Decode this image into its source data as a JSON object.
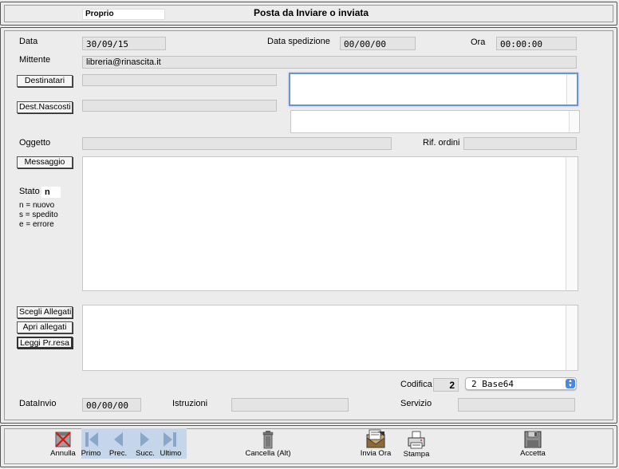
{
  "header": {
    "badge": "Proprio",
    "title": "Posta da Inviare o inviata"
  },
  "form": {
    "data_label": "Data",
    "data_value": "30/09/15",
    "data_spedizione_label": "Data spedizione",
    "data_spedizione_value": "00/00/00",
    "ora_label": "Ora",
    "ora_value": "00:00:00",
    "mittente_label": "Mittente",
    "mittente_value": "libreria@rinascita.it",
    "destinatari_button": "Destinatari",
    "dest_nascosti_button": "Dest.Nascosti",
    "oggetto_label": "Oggetto",
    "rif_ordini_label": "Rif. ordini",
    "messaggio_button": "Messaggio",
    "stato_label": "Stato",
    "stato_value": "n",
    "legend": [
      "n = nuovo",
      "s = spedito",
      "e = errore"
    ],
    "scegli_allegati_button": "Scegli Allegati",
    "apri_allegati_button": "Apri allegati",
    "leggi_prresa_button": "Leggi Pr.resa",
    "codifica_label": "Codifica",
    "codifica_number": "2",
    "codifica_select": "2 Base64",
    "data_invio_label": "DataInvio",
    "data_invio_value": "00/00/00",
    "istruzioni_label": "Istruzioni",
    "servizio_label": "Servizio"
  },
  "toolbar": {
    "annulla": "Annulla",
    "primo": "Primo",
    "prec": "Prec.",
    "succ": "Succ.",
    "ultimo": "Ultimo",
    "cancella": "Cancella (Alt)",
    "invia_ora": "Invia Ora",
    "stampa": "Stampa",
    "accetta": "Accetta"
  },
  "colors": {
    "focus_blue": "#6c93d4",
    "nav_bg": "#c6d6ea",
    "nav_icon": "#8aa6c8"
  }
}
